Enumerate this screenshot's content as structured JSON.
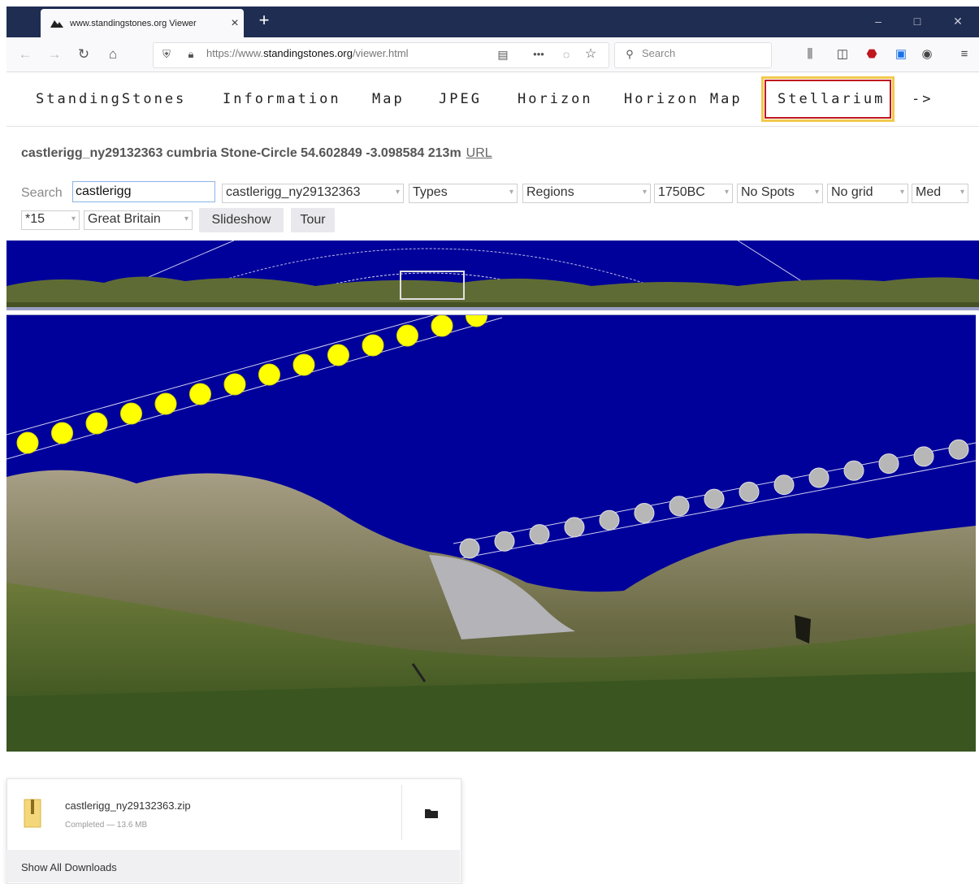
{
  "browser": {
    "tab_title": "www.standingstones.org Viewer",
    "url_prefix": "https://www.",
    "url_domain": "standingstones.org",
    "url_path": "/viewer.html",
    "search_placeholder": "Search",
    "window_controls": [
      "–",
      "□",
      "✕"
    ]
  },
  "site_nav": {
    "items": [
      "StandingStones",
      "Information",
      "Map",
      "JPEG",
      "Horizon",
      "Horizon Map",
      "Stellarium",
      "->"
    ],
    "highlighted": "Stellarium"
  },
  "site": {
    "heading": "castlerigg_ny29132363 cumbria Stone-Circle 54.602849 -3.098584 213m",
    "heading_link": "URL",
    "search_label": "Search",
    "search_value": "castlerigg",
    "selects": {
      "site": "castlerigg_ny29132363",
      "types": "Types",
      "regions": "Regions",
      "date": "1750BC",
      "spots": "No Spots",
      "grid": "No grid",
      "quality": "Med",
      "zoom": "*15",
      "country": "Great Britain"
    },
    "buttons": {
      "slideshow": "Slideshow",
      "tour": "Tour"
    }
  },
  "downloads": {
    "file_name": "castlerigg_ny29132363.zip",
    "status": "Completed — 13.6 MB",
    "show_all": "Show All Downloads"
  },
  "colors": {
    "tabbar": "#1f2d52",
    "sky": "#00009a",
    "sun": "#ffff00",
    "moon": "#b7b7b7",
    "highlight_outer": "#f2c94c",
    "highlight_inner": "#c0171f"
  }
}
